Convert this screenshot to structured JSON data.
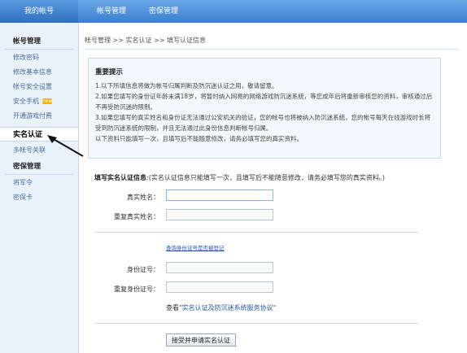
{
  "header": {
    "tabs": [
      {
        "label": "我的帐号"
      },
      {
        "label": "帐号管理"
      },
      {
        "label": "密保管理"
      }
    ]
  },
  "sidebar": {
    "account_section": "帐号管理",
    "items": [
      {
        "label": "修改密码"
      },
      {
        "label": "修改基本信息"
      },
      {
        "label": "帐号安全设置"
      },
      {
        "label": "安全手机",
        "badge": "new"
      },
      {
        "label": "开通游戏付费"
      },
      {
        "label": "实名认证",
        "active": true
      },
      {
        "label": "多帐号关联"
      }
    ],
    "security_section": "密保管理",
    "security_items": [
      {
        "label": "将军令"
      },
      {
        "label": "密保卡"
      }
    ]
  },
  "breadcrumb": "帐号管理 >> 实名认证 >> 填写认证信息",
  "notice": {
    "title": "重要提示",
    "lines": [
      "1.以下所填信息将做为帐号归属判断及防沉迷认证之用，敬请留意。",
      "2.如果您填写的身份证年龄未满18岁，将暂时纳入网易的网络游戏防沉迷系统，等您成年后将重新审核您的资料，审核通过后不再受防沉迷的限制。",
      "3.如果您填写的真实姓名和身份证无法通过公安机关的验证，您的帐号也将被纳入防沉迷系统，您的帐号每天在线游戏时长将受到防沉迷系统的限制，并且无法通过此身份信息判断帐号归属。",
      "以下资料只能填写一次，且填写后不能随意修改，请务必填写您的真实资料。"
    ]
  },
  "form": {
    "heading": "填写实名认证信息",
    "heading_note": ":(实名认证信息只能填写一次，且填写后不能随意修改，请务必填写您的真实资料。)",
    "real_name_label": "真实姓名：",
    "real_name_confirm_label": "重复真实姓名：",
    "query_link": "查询身份证号是否被登记",
    "id_label": "身份证号：",
    "id_confirm_label": "重复身份证号：",
    "agreement_prefix": "查看",
    "agreement_link": "\"实名认证及防沉迷系统服务协议\"",
    "submit_label": "接受并申请实名认证"
  },
  "colors": {
    "header_blue": "#3c7fd0",
    "sidebar_bg": "#e9f1fb",
    "link": "#2255aa",
    "badge": "#f0b400"
  }
}
